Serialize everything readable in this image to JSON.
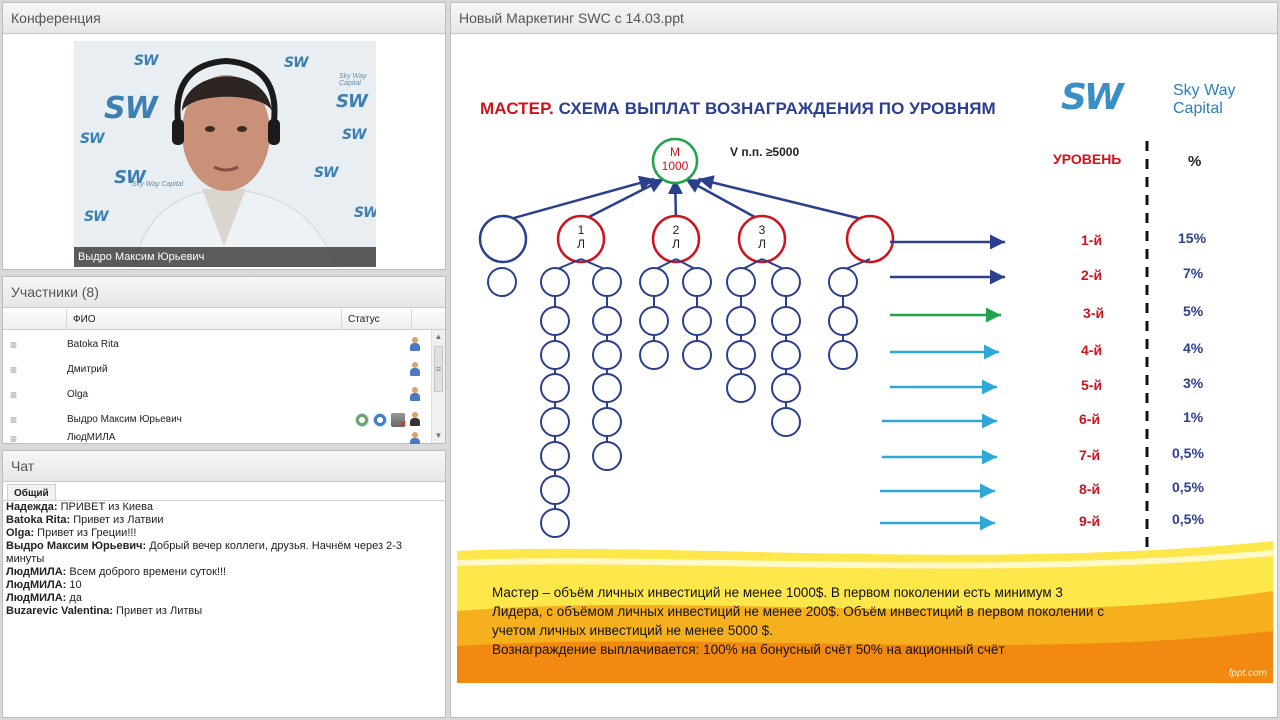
{
  "conference": {
    "title": "Конференция",
    "video_caption": "Выдро Максим Юрьевич",
    "backdrop_logo": "SW",
    "backdrop_sub": "Sky Way Capital"
  },
  "participants": {
    "title": "Участники (8)",
    "columns": [
      "ФИО",
      "Статус"
    ],
    "rows": [
      {
        "name": "Batoka Rita"
      },
      {
        "name": "Дмитрий"
      },
      {
        "name": "Olga"
      },
      {
        "name": "Выдро Максим Юрьевич"
      },
      {
        "name": "ЛюдМИЛА"
      }
    ]
  },
  "chat": {
    "title": "Чат",
    "tab": "Общий",
    "messages": [
      {
        "author": "Надежда:",
        "text": " ПРИВЕТ из Киева"
      },
      {
        "author": "Batoka Rita:",
        "text": " Привет из Латвии"
      },
      {
        "author": "Olga:",
        "text": " Привет из Греции!!!"
      },
      {
        "author": "Выдро Максим Юрьевич:",
        "text": " Добрый вечер коллеги, друзья. Начнём через 2-3 минуты"
      },
      {
        "author": "ЛюдМИЛА:",
        "text": " Всем доброго времени суток!!!"
      },
      {
        "author": "ЛюдМИЛА:",
        "text": " 10"
      },
      {
        "author": "ЛюдМИЛА:",
        "text": " да"
      },
      {
        "author": "Buzarevic Valentina:",
        "text": " Привет из Литвы"
      }
    ]
  },
  "presentation": {
    "title": "Новый Маркетинг SWC с 14.03.ppt",
    "slide": {
      "title_red": "МАСТЕР.",
      "title_rest": " СХЕМА ВЫПЛАТ ВОЗНАГРАЖДЕНИЯ  ПО УРОВНЯМ",
      "brand_logo": "SW",
      "brand_line1": "Sky Way",
      "brand_line2": "Capital",
      "top_node": {
        "line1": "М",
        "line2": "1000"
      },
      "volume_label": "V п.п. ≥5000",
      "leader_nodes": [
        {
          "line1": "1",
          "line2": "Л"
        },
        {
          "line1": "2",
          "line2": "Л"
        },
        {
          "line1": "3",
          "line2": "Л"
        }
      ],
      "header_level": "УРОВЕНЬ",
      "header_percent": "%",
      "levels": [
        {
          "level": "1-й",
          "percent": "15%",
          "arrow_color": "#2b3f8f"
        },
        {
          "level": "2-й",
          "percent": "7%",
          "arrow_color": "#2b3f8f"
        },
        {
          "level": "3-й",
          "percent": "5%",
          "arrow_color": "#22a34a"
        },
        {
          "level": "4-й",
          "percent": "4%",
          "arrow_color": "#2fa8d8"
        },
        {
          "level": "5-й",
          "percent": "3%",
          "arrow_color": "#2fa8d8"
        },
        {
          "level": "6-й",
          "percent": "1%",
          "arrow_color": "#2fa8d8"
        },
        {
          "level": "7-й",
          "percent": "0,5%",
          "arrow_color": "#2fa8d8"
        },
        {
          "level": "8-й",
          "percent": "0,5%",
          "arrow_color": "#2fa8d8"
        },
        {
          "level": "9-й",
          "percent": "0,5%",
          "arrow_color": "#2fa8d8"
        }
      ],
      "footer_lines": [
        "Мастер – объём личных  инвестиций  не менее 1000$. В первом поколении  есть минимум  3",
        "Лидера, с объёмом личных  инвестиций  не менее 200$. Объём инвестиций  в первом поколении  с",
        "учетом личных  инвестиций  не менее 5000 $.",
        "Вознаграждение выплачивается:  100% на бонусный счёт   50% на акционный  счёт"
      ],
      "watermark": "fppt.com",
      "colors": {
        "red": "#d0121b",
        "navy": "#2b3f8f",
        "orange": "#f28a12",
        "yellow": "#fde74a"
      }
    }
  }
}
